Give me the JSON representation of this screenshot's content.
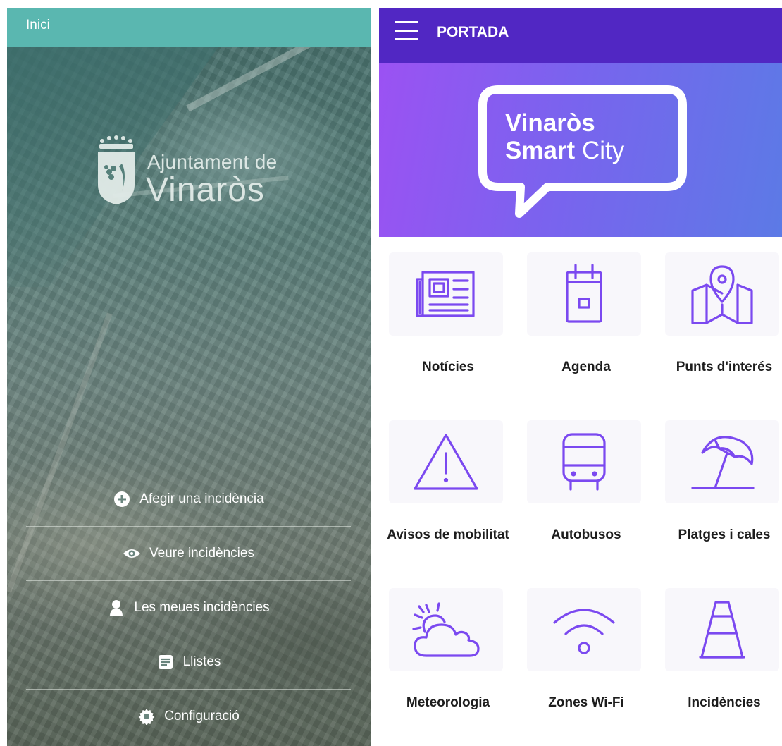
{
  "left_app": {
    "header_title": "Inici",
    "logo": {
      "line1": "Ajuntament de",
      "line2": "Vinaròs"
    },
    "menu": [
      {
        "label": "Afegir una incidència",
        "icon": "plus-circle-icon"
      },
      {
        "label": "Veure incidències",
        "icon": "eye-icon"
      },
      {
        "label": "Les meues incidències",
        "icon": "person-icon"
      },
      {
        "label": "Llistes",
        "icon": "list-icon"
      },
      {
        "label": "Configuració",
        "icon": "gear-icon"
      }
    ]
  },
  "right_app": {
    "header_title": "PORTADA",
    "brand": {
      "line1": "Vinaròs",
      "line2_bold": "Smart",
      "line2_rest": "City"
    },
    "colors": {
      "header": "#5127c3",
      "accent": "#7b49f0",
      "hero_start": "#9b52f3",
      "hero_end": "#5c7ae6"
    },
    "tiles": [
      {
        "label": "Notícies",
        "icon": "newspaper-icon"
      },
      {
        "label": "Agenda",
        "icon": "calendar-icon"
      },
      {
        "label": "Punts d'interés",
        "icon": "map-pin-icon"
      },
      {
        "label": "Avisos de mobilitat",
        "icon": "warning-icon"
      },
      {
        "label": "Autobusos",
        "icon": "bus-icon"
      },
      {
        "label": "Platges i cales",
        "icon": "beach-umbrella-icon"
      },
      {
        "label": "Meteorologia",
        "icon": "weather-icon"
      },
      {
        "label": "Zones Wi-Fi",
        "icon": "wifi-icon"
      },
      {
        "label": "Incidències",
        "icon": "traffic-cone-icon"
      }
    ]
  }
}
